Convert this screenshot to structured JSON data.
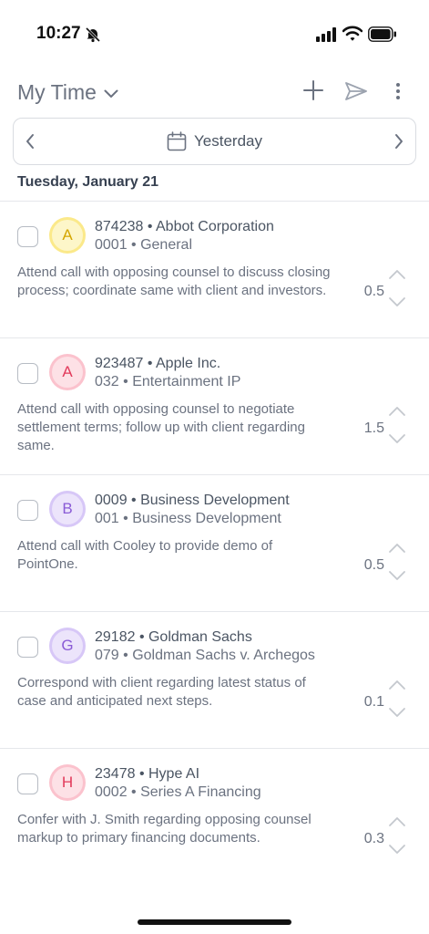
{
  "status_bar": {
    "time": "10:27"
  },
  "header": {
    "title": "My Time"
  },
  "date_nav": {
    "label": "Yesterday"
  },
  "day_heading": "Tuesday, January 21",
  "entries": [
    {
      "avatar_letter": "A",
      "avatar_bg": "#fdf6c9",
      "avatar_ring": "#fbe98a",
      "avatar_fg": "#d4a600",
      "client": "874238 • Abbot Corporation",
      "matter": "0001 • General",
      "narrative": "Attend call with opposing counsel to discuss closing process; coordinate same with client and investors.",
      "hours": "0.5"
    },
    {
      "avatar_letter": "A",
      "avatar_bg": "#fde1e6",
      "avatar_ring": "#fbc2cd",
      "avatar_fg": "#e23a5b",
      "client": "923487 • Apple Inc.",
      "matter": "032 • Entertainment IP",
      "narrative": "Attend call with opposing counsel to negotiate settlement terms; follow up with client regarding same.",
      "hours": "1.5"
    },
    {
      "avatar_letter": "B",
      "avatar_bg": "#ece4fb",
      "avatar_ring": "#d7c7f7",
      "avatar_fg": "#8a5bd6",
      "client": "0009 • Business Development",
      "matter": "001 • Business Development",
      "narrative": "Attend call with Cooley to provide demo of PointOne.",
      "hours": "0.5"
    },
    {
      "avatar_letter": "G",
      "avatar_bg": "#ece4fb",
      "avatar_ring": "#d7c7f7",
      "avatar_fg": "#8a5bd6",
      "client": "29182 • Goldman Sachs",
      "matter": "079 • Goldman Sachs v. Archegos",
      "narrative": "Correspond with client regarding latest status of case and anticipated next steps.",
      "hours": "0.1"
    },
    {
      "avatar_letter": "H",
      "avatar_bg": "#fde1e6",
      "avatar_ring": "#fbc2cd",
      "avatar_fg": "#e23a5b",
      "client": "23478 • Hype AI",
      "matter": "0002 • Series A Financing",
      "narrative": "Confer with J. Smith regarding opposing counsel markup to primary financing documents.",
      "hours": "0.3"
    }
  ]
}
